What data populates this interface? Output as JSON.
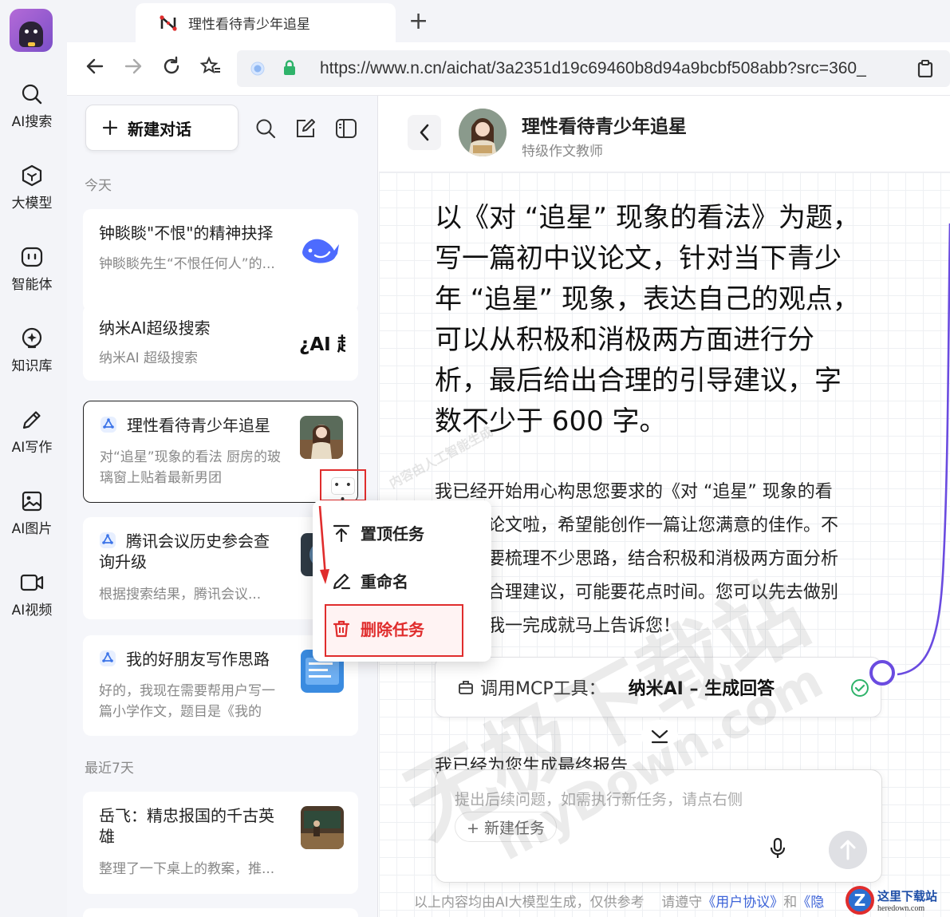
{
  "rail": {
    "items": [
      {
        "label": "AI搜索",
        "icon": "search-icon"
      },
      {
        "label": "大模型",
        "icon": "cube-icon"
      },
      {
        "label": "智能体",
        "icon": "agent-icon"
      },
      {
        "label": "知识库",
        "icon": "knowledge-icon"
      },
      {
        "label": "AI写作",
        "icon": "pen-icon"
      },
      {
        "label": "AI图片",
        "icon": "image-icon"
      },
      {
        "label": "AI视频",
        "icon": "video-icon"
      }
    ]
  },
  "browser": {
    "tab_title": "理性看待青少年追星",
    "url": "https://www.n.cn/aichat/3a2351d19c69460b8d94a9bcbf508abb?src=360_"
  },
  "sidebar": {
    "new_chat_label": "新建对话",
    "group_today": "今天",
    "group_week": "最近7天",
    "cards": [
      {
        "title": "钟睒睒\"不恨\"的精神抉择",
        "subtitle": "钟睒睒先生“不恨任何人”的...",
        "thumb_icon": "whale-icon"
      },
      {
        "title": "纳米AI超级搜索",
        "subtitle": "纳米AI 超级搜索",
        "thumb_text": "¿AI 超"
      },
      {
        "title": "理性看待青少年追星",
        "subtitle_line1": "对“追星”现象的看法 厨房的玻",
        "subtitle_line2": "璃窗上贴着最新男团",
        "more": "• • •"
      },
      {
        "title_line1": "腾讯会议历史参会查",
        "title_line2": "询升级",
        "subtitle": "根据搜索结果，腾讯会议..."
      },
      {
        "title": "我的好朋友写作思路",
        "subtitle_line1": "好的，我现在需要帮用户写一",
        "subtitle_line2": "篇小学作文，题目是《我的"
      },
      {
        "title_line1": "岳飞：精忠报国的千古英",
        "title_line2": "雄",
        "subtitle": "整理了一下桌上的教案，推..."
      }
    ]
  },
  "menu": {
    "pin": "置顶任务",
    "rename": "重命名",
    "delete": "删除任务"
  },
  "chat": {
    "title": "理性看待青少年追星",
    "subtitle": "特级作文教师",
    "question_lines": [
      "以《对 “追星” 现象的看法》为题，",
      "写一篇初中议论文，针对当下青少",
      "年 “追星” 现象，表达自己的观点，",
      "可以从积极和消极两方面进行分",
      "析，最后给出合理的引导建议，字",
      "数不少于 600 字。"
    ],
    "answer_lines": [
      "我已经开始用心构思您要求的《对 “追星” 现象的看",
      "法》议论文啦，希望能创作一篇让您满意的佳作。不",
      "过这需要梳理不少思路，结合积极和消极两方面分析",
      "并给出合理建议，可能要花点时间。您可以先去做别",
      "的事，我一完成就马上告诉您！"
    ],
    "mcp_label": "调用MCP工具：",
    "mcp_value": "纳米AI – 生成回答",
    "report_text": "我已经为您生成最终报告",
    "input_placeholder": "提出后续问题，如需执行新任务，请点右侧",
    "new_task": "+ 新建任务",
    "footer_prefix": "以上内容均由AI大模型生成，仅供参考",
    "footer_mid": "请遵守",
    "footer_link1": "《用户协议》",
    "footer_and": "和",
    "footer_link2": "《隐"
  },
  "watermark": {
    "text": "无极下载站",
    "latin": "myDown.com",
    "small": "内容由人工智能生成"
  },
  "site_logo": {
    "name": "这里下载站",
    "domain": "heredown.com"
  },
  "colors": {
    "accent_purple": "#6a4be0",
    "danger_red": "#e02d2d",
    "check_green": "#2fb36a",
    "link_blue": "#3c63d8"
  }
}
